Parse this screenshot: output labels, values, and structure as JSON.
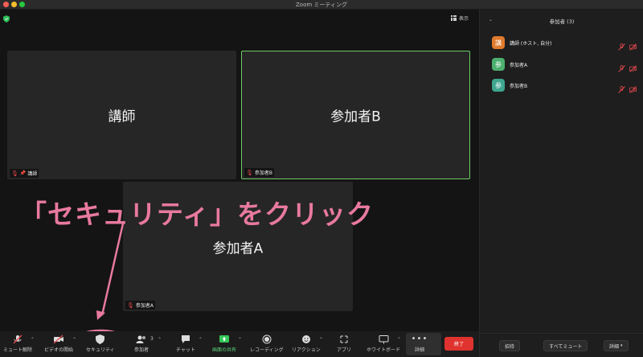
{
  "window": {
    "title": "Zoom ミーティング"
  },
  "view": {
    "label": "表示"
  },
  "tiles": [
    {
      "name": "講師",
      "label": "講師"
    },
    {
      "name": "参加者B",
      "label": "参加者B"
    },
    {
      "name": "参加者A",
      "label": "参加者A"
    }
  ],
  "annotation": {
    "text": "「セキュリティ」をクリック",
    "color": "#e8799f"
  },
  "toolbar": {
    "mute": "ミュート解除",
    "video": "ビデオの開始",
    "security": "セキュリティ",
    "participants": "参加者",
    "participants_count": "3",
    "chat": "チャット",
    "share": "画面の共有",
    "record": "レコーディング",
    "reactions": "リアクション",
    "apps": "アプリ",
    "whiteboard": "ホワイトボード",
    "more": "詳細",
    "end": "終了"
  },
  "panel": {
    "title": "参加者 (3)",
    "participants": [
      {
        "avatar": "講",
        "name": "講師 (ホスト, 自分)",
        "color": "#e07b2d"
      },
      {
        "avatar": "参",
        "name": "参加者A",
        "color": "#4caf6e"
      },
      {
        "avatar": "参",
        "name": "参加者B",
        "color": "#3fa58f"
      }
    ],
    "invite": "招待",
    "mute_all": "すべてミュート",
    "details": "詳細"
  },
  "colors": {
    "active_border": "#6ccb63",
    "end_button": "#e0332f",
    "muted": "#e5484d"
  }
}
